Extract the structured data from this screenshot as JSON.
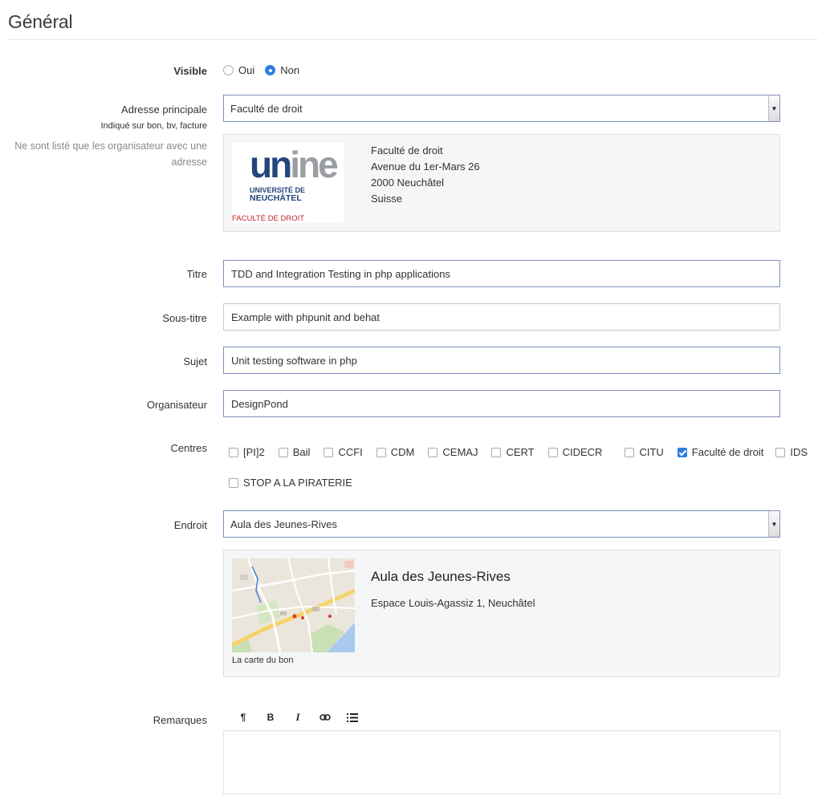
{
  "section": {
    "title": "Général"
  },
  "visible": {
    "label": "Visible",
    "options": [
      {
        "label": "Oui",
        "checked": false
      },
      {
        "label": "Non",
        "checked": true
      }
    ]
  },
  "adresse": {
    "label": "Adresse principale",
    "sublabel": "Indiqué sur bon, bv, facture",
    "help": "Ne sont listé que les organisateur avec une adresse",
    "selected": "Faculté de droit",
    "logo": {
      "un": "un",
      "ine": "ine",
      "line1": "UNIVERSITÉ DE",
      "line2": "NEUCHÂTEL",
      "faculty": "FACULTÉ DE DROIT"
    },
    "lines": [
      "Faculté de droit",
      "Avenue du 1er-Mars 26",
      "2000 Neuchâtel",
      "Suisse"
    ]
  },
  "titre": {
    "label": "Titre",
    "value": "TDD and Integration Testing in php applications"
  },
  "sous_titre": {
    "label": "Sous-titre",
    "value": "Example with phpunit and behat"
  },
  "sujet": {
    "label": "Sujet",
    "value": "Unit testing software in php"
  },
  "organisateur": {
    "label": "Organisateur",
    "value": "DesignPond"
  },
  "centres": {
    "label": "Centres",
    "items": [
      {
        "label": "[PI]2",
        "checked": false
      },
      {
        "label": "Bail",
        "checked": false
      },
      {
        "label": "CCFI",
        "checked": false
      },
      {
        "label": "CDM",
        "checked": false
      },
      {
        "label": "CEMAJ",
        "checked": false
      },
      {
        "label": "CERT",
        "checked": false
      },
      {
        "label": "CIDECR",
        "checked": false
      },
      {
        "label": "CITU",
        "checked": false
      },
      {
        "label": "Faculté de droit",
        "checked": true
      },
      {
        "label": "IDS",
        "checked": false
      },
      {
        "label": "STOP A LA PIRATERIE",
        "checked": false
      }
    ]
  },
  "endroit": {
    "label": "Endroit",
    "selected": "Aula des Jeunes-Rives",
    "place_name": "Aula des Jeunes-Rives",
    "place_address": "Espace Louis-Agassiz 1, Neuchâtel",
    "map_caption": "La carte du bon"
  },
  "remarques": {
    "label": "Remarques",
    "toolbar": [
      {
        "icon": "pilcrow-icon",
        "glyph": "¶"
      },
      {
        "icon": "bold-icon",
        "glyph": "B"
      },
      {
        "icon": "italic-icon",
        "glyph": "I"
      },
      {
        "icon": "link-icon",
        "glyph": ""
      },
      {
        "icon": "list-icon",
        "glyph": ""
      }
    ],
    "value": ""
  },
  "colors": {
    "accent": "#2f7de0",
    "logo_blue": "#23467d",
    "logo_grey": "#9a9ea3",
    "logo_red": "#c0222a"
  }
}
